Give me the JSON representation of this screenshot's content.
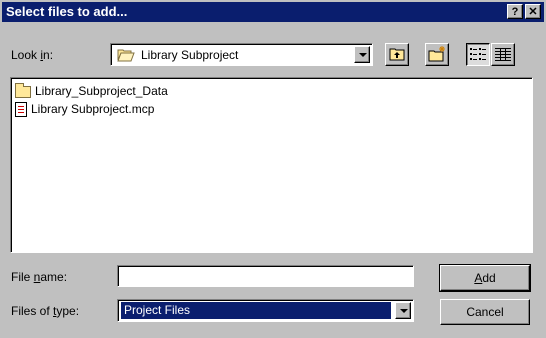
{
  "window": {
    "title": "Select files to add...",
    "help_label": "?",
    "close_label": "✕"
  },
  "look_in": {
    "label_pre": "Look ",
    "label_key": "i",
    "label_post": "n:",
    "value": "Library Subproject",
    "icon": "folder-open-icon"
  },
  "toolbar": {
    "icons": [
      "up-folder-icon",
      "new-folder-icon",
      "list-view-icon",
      "details-view-icon"
    ]
  },
  "files": [
    {
      "name": "Library_Subproject_Data",
      "icon": "folder-icon"
    },
    {
      "name": "Library Subproject.mcp",
      "icon": "mcp-file-icon"
    }
  ],
  "file_name": {
    "label_pre": "File ",
    "label_key": "n",
    "label_post": "ame:",
    "value": ""
  },
  "file_type": {
    "label_pre": "Files of ",
    "label_key": "t",
    "label_post": "ype:",
    "value": "Project Files"
  },
  "buttons": {
    "add_key": "A",
    "add_rest": "dd",
    "cancel": "Cancel"
  },
  "colors": {
    "titlebar": "#0a1e6e",
    "face": "#c0c0c0",
    "selection": "#0a1e6e"
  }
}
